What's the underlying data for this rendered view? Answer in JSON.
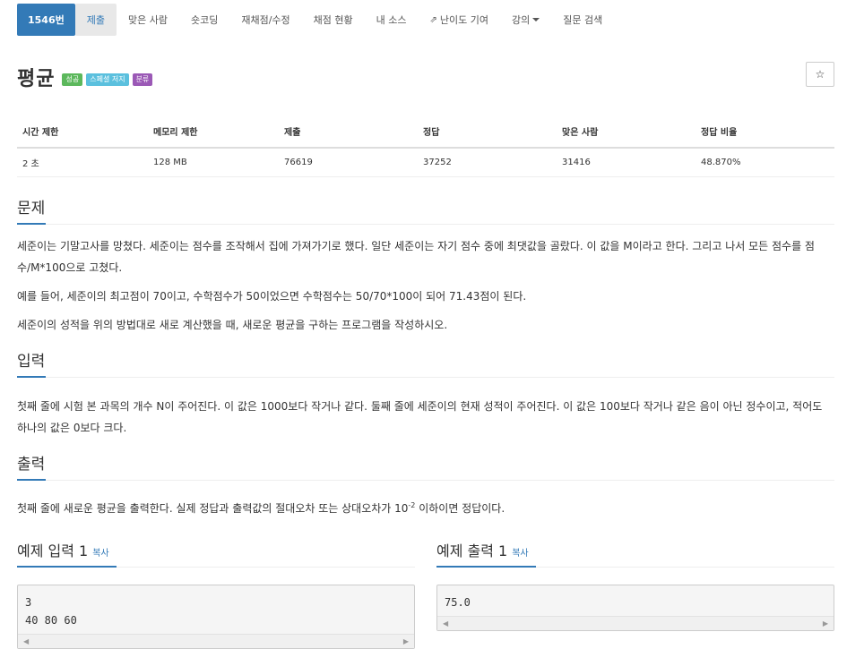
{
  "nav": {
    "problem_id": "1546번",
    "items": [
      "제출",
      "맞은 사람",
      "숏코딩",
      "재채점/수정",
      "채점 현황",
      "내 소스",
      "난이도 기여",
      "강의",
      "질문 검색"
    ]
  },
  "title": "평균",
  "badges": [
    "성공",
    "스페셜 저지",
    "분류"
  ],
  "star": "☆",
  "info": {
    "headers": [
      "시간 제한",
      "메모리 제한",
      "제출",
      "정답",
      "맞은 사람",
      "정답 비율"
    ],
    "values": [
      "2 초",
      "128 MB",
      "76619",
      "37252",
      "31416",
      "48.870%"
    ]
  },
  "problem": {
    "heading": "문제",
    "p1": "세준이는 기말고사를 망쳤다. 세준이는 점수를 조작해서 집에 가져가기로 했다. 일단 세준이는 자기 점수 중에 최댓값을 골랐다. 이 값을 M이라고 한다. 그리고 나서 모든 점수를 점수/M*100으로 고쳤다.",
    "p2": "예를 들어, 세준이의 최고점이 70이고, 수학점수가 50이었으면 수학점수는 50/70*100이 되어 71.43점이 된다.",
    "p3": "세준이의 성적을 위의 방법대로 새로 계산했을 때, 새로운 평균을 구하는 프로그램을 작성하시오."
  },
  "input": {
    "heading": "입력",
    "p1": "첫째 줄에 시험 본 과목의 개수 N이 주어진다. 이 값은 1000보다 작거나 같다. 둘째 줄에 세준이의 현재 성적이 주어진다. 이 값은 100보다 작거나 같은 음이 아닌 정수이고, 적어도 하나의 값은 0보다 크다."
  },
  "output": {
    "heading": "출력",
    "p1_a": "첫째 줄에 새로운 평균을 출력한다. 실제 정답과 출력값의 절대오차 또는 상대오차가 10",
    "p1_sup": "-2",
    "p1_b": " 이하이면 정답이다."
  },
  "sample_input": {
    "title": "예제 입력 1",
    "copy": "복사",
    "line1": "3",
    "line2": "40 80 60"
  },
  "sample_output": {
    "title": "예제 출력 1",
    "copy": "복사",
    "line1": "75.0"
  },
  "colors": {
    "primary": "#337ab7",
    "success": "#5cb85c",
    "info": "#5bc0de",
    "purple": "#9b59b6"
  }
}
